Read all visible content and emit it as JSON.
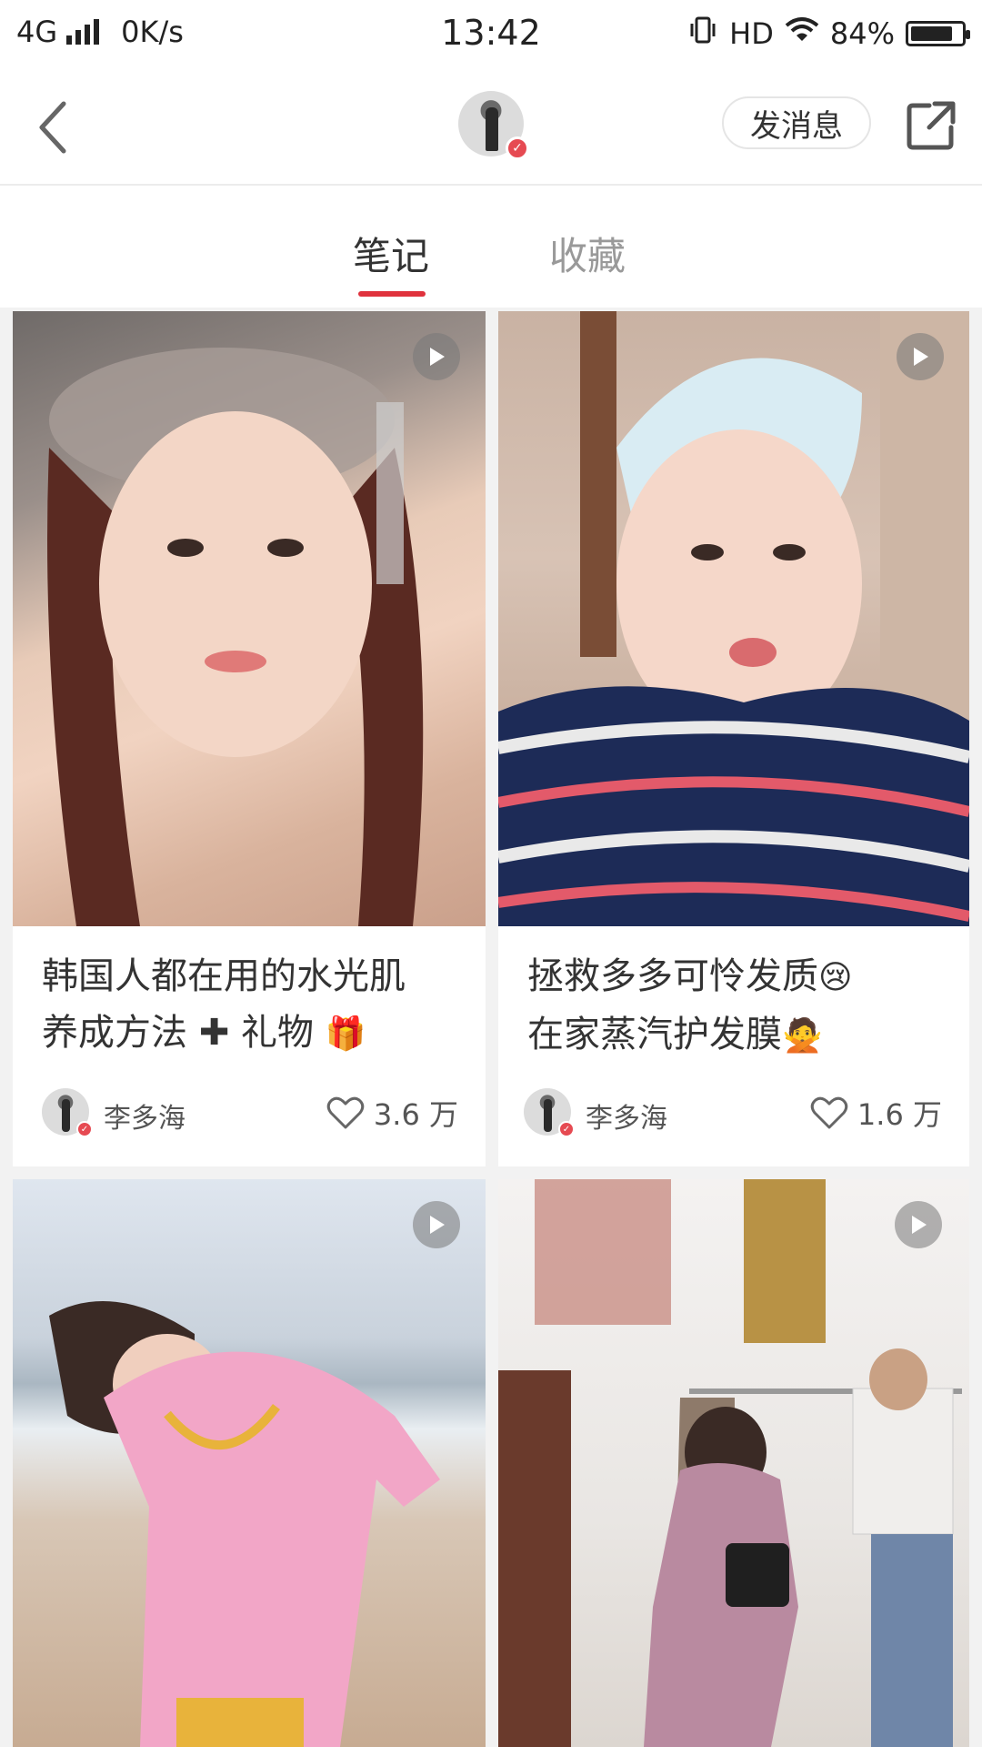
{
  "status_bar": {
    "network": "4G",
    "speed": "0K/s",
    "time": "13:42",
    "hd": "HD",
    "battery": "84%",
    "battery_level": 0.84
  },
  "nav": {
    "message_label": "发消息"
  },
  "tabs": [
    {
      "label": "笔记",
      "active": true
    },
    {
      "label": "收藏",
      "active": false
    }
  ],
  "notes": [
    {
      "title_line1": "韩国人都在用的水光肌",
      "title_line2": "养成方法 ✚ 礼物",
      "title_emoji": "🎁",
      "author": "李多海",
      "likes": "3.6 万",
      "is_video": true
    },
    {
      "title_line1": "拯救多多可怜发质",
      "title_line1_emoji": "😢",
      "title_line2": "在家蒸汽护发膜",
      "title_emoji": "🙅",
      "author": "李多海",
      "likes": "1.6 万",
      "is_video": true
    },
    {
      "is_video": true
    },
    {
      "is_video": true
    }
  ],
  "colors": {
    "accent": "#e0323d",
    "background": "#f2f2f2"
  }
}
